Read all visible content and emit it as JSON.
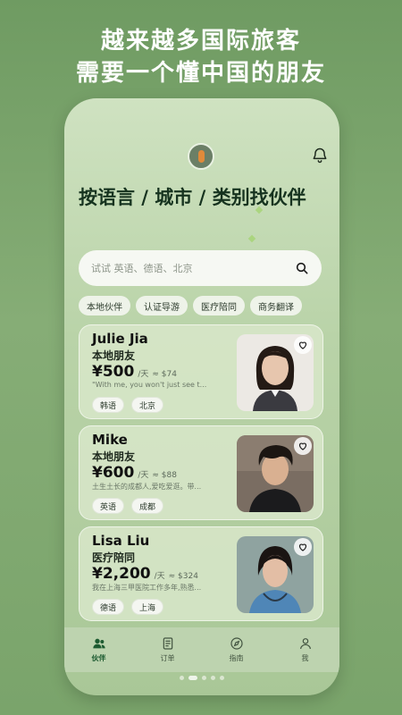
{
  "headline": {
    "line1": "越来越多国际旅客",
    "line2": "需要一个懂中国的朋友"
  },
  "header": {
    "logo_icon": "app-logo",
    "bell_icon": "bell-icon"
  },
  "page_title": "按语言 / 城市 / 类别找伙伴",
  "search": {
    "placeholder": "试试 英语、德语、北京",
    "icon": "search-icon"
  },
  "chips": [
    "本地伙伴",
    "认证导游",
    "医疗陪同",
    "商务翻译"
  ],
  "cards": [
    {
      "name": "Julie Jia",
      "role": "本地朋友",
      "price": "¥500",
      "unit": "/天",
      "usd": "≈ $74",
      "desc": "\"With me, you won't just see t...",
      "tags": [
        "韩语",
        "北京"
      ],
      "photo_colors": {
        "bg": "#ece9e4",
        "hair": "#241a15",
        "skin": "#e7c6ae",
        "shirt": "#3a3a40"
      }
    },
    {
      "name": "Mike",
      "role": "本地朋友",
      "price": "¥600",
      "unit": "/天",
      "usd": "≈ $88",
      "desc": "土生土长的成都人,爱吃爱逛。带...",
      "tags": [
        "英语",
        "成都"
      ],
      "photo_colors": {
        "bg": "#7a6d62",
        "hair": "#1c1612",
        "skin": "#d9b091",
        "shirt": "#1b1b1d"
      }
    },
    {
      "name": "Lisa Liu",
      "role": "医疗陪同",
      "price": "¥2,200",
      "unit": "/天",
      "usd": "≈ $324",
      "desc": "我在上海三甲医院工作多年,熟悉...",
      "tags": [
        "德语",
        "上海"
      ],
      "photo_colors": {
        "bg": "#8fa3a0",
        "hair": "#1a1412",
        "skin": "#e3bea5",
        "shirt": "#4f86b7"
      }
    }
  ],
  "tabs": [
    {
      "label": "伙伴",
      "icon": "people-icon",
      "active": true
    },
    {
      "label": "订单",
      "icon": "orders-icon",
      "active": false
    },
    {
      "label": "指南",
      "icon": "compass-icon",
      "active": false
    },
    {
      "label": "我",
      "icon": "person-icon",
      "active": false
    }
  ],
  "pager": {
    "count": 5,
    "active": 0
  },
  "colors": {
    "accent": "#1d5b31",
    "background": "#7aa46b"
  }
}
